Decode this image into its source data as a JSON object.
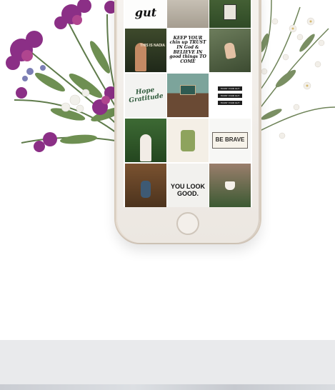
{
  "phone_screen": {
    "grid_tiles": [
      {
        "id": "gut",
        "text": "gut"
      },
      {
        "id": "window-photo",
        "text": ""
      },
      {
        "id": "ivy-window",
        "text": ""
      },
      {
        "id": "this-is-nadia",
        "text": "THIS IS NADIA"
      },
      {
        "id": "keep-your-chin-up",
        "text": "KEEP YOUR chin up TRUST IN God & BELIEVE IN good things TO COME"
      },
      {
        "id": "hand-wave",
        "text": ""
      },
      {
        "id": "lettering-green",
        "text": "Hope Gratitude"
      },
      {
        "id": "chalkboard-sign",
        "text": ""
      },
      {
        "id": "trust-bars",
        "text": "TRUST YOUR GUT"
      },
      {
        "id": "woman-greenery",
        "text": ""
      },
      {
        "id": "cactus-post",
        "text": ""
      },
      {
        "id": "be-brave",
        "text": "BE BRAVE"
      },
      {
        "id": "bench-photo",
        "text": ""
      },
      {
        "id": "you-look-good",
        "text": "YOU LOOK GOOD."
      },
      {
        "id": "cup-palms",
        "text": ""
      }
    ]
  },
  "colors": {
    "background": "#ffffff",
    "band": "#e9eaec",
    "phone_body": "#f3eee8",
    "flower_purple": "#7b2f87",
    "foliage_green": "#5f7b4b"
  }
}
